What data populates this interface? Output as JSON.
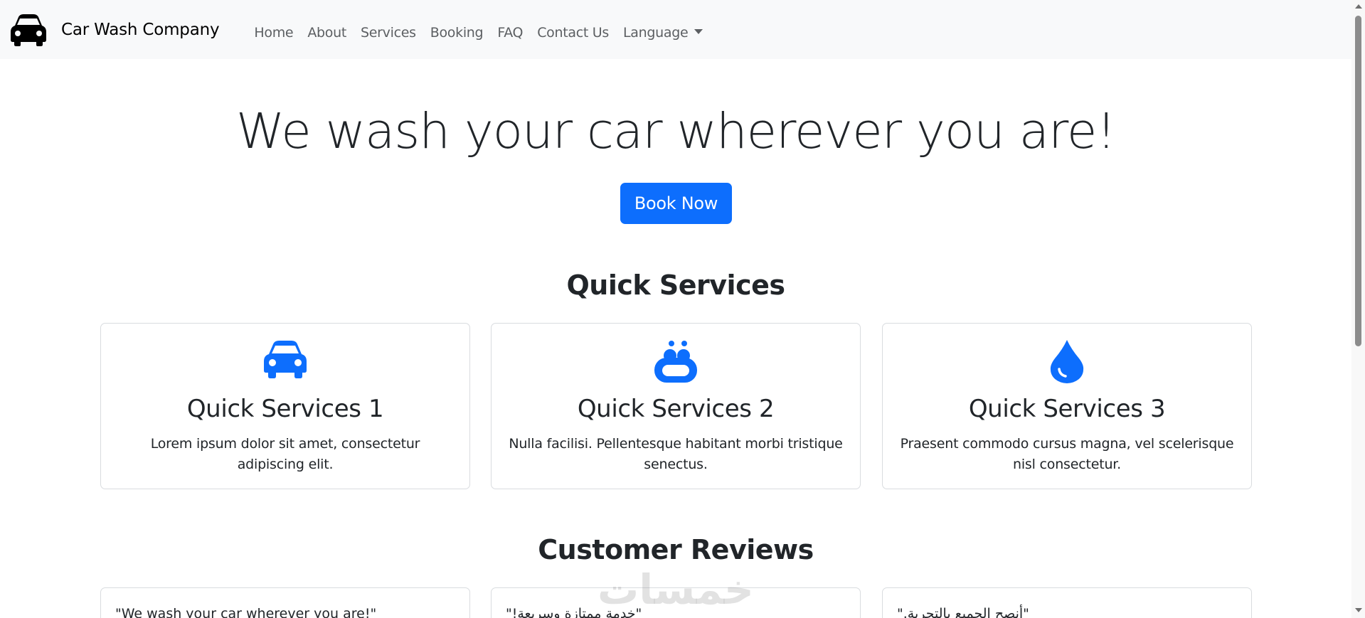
{
  "brand": {
    "name": "Car Wash Company",
    "icon": "car-icon"
  },
  "nav": {
    "items": [
      {
        "label": "Home"
      },
      {
        "label": "About"
      },
      {
        "label": "Services"
      },
      {
        "label": "Booking"
      },
      {
        "label": "FAQ"
      },
      {
        "label": "Contact Us"
      }
    ],
    "language_label": "Language"
  },
  "hero": {
    "title": "We wash your car wherever you are!",
    "button_label": "Book Now"
  },
  "quick_services": {
    "title": "Quick Services",
    "cards": [
      {
        "icon": "car-icon",
        "title": "Quick Services 1",
        "text": "Lorem ipsum dolor sit amet, consectetur adipiscing elit."
      },
      {
        "icon": "soap-icon",
        "title": "Quick Services 2",
        "text": "Nulla facilisi. Pellentesque habitant morbi tristique senectus."
      },
      {
        "icon": "droplet-icon",
        "title": "Quick Services 3",
        "text": "Praesent commodo cursus magna, vel scelerisque nisl consectetur."
      }
    ]
  },
  "reviews": {
    "title": "Customer Reviews",
    "items": [
      {
        "text": "\"We wash your car wherever you are!\""
      },
      {
        "text": "\"خدمة ممتازة وسريعة!\""
      },
      {
        "text": "\"أنصح الجميع بالتجربة.\""
      }
    ]
  },
  "watermark": "خمسات",
  "colors": {
    "primary": "#0d6efd",
    "navbar_bg": "#f8f9fa",
    "text": "#212529",
    "nav_link": "#5c5f62"
  }
}
